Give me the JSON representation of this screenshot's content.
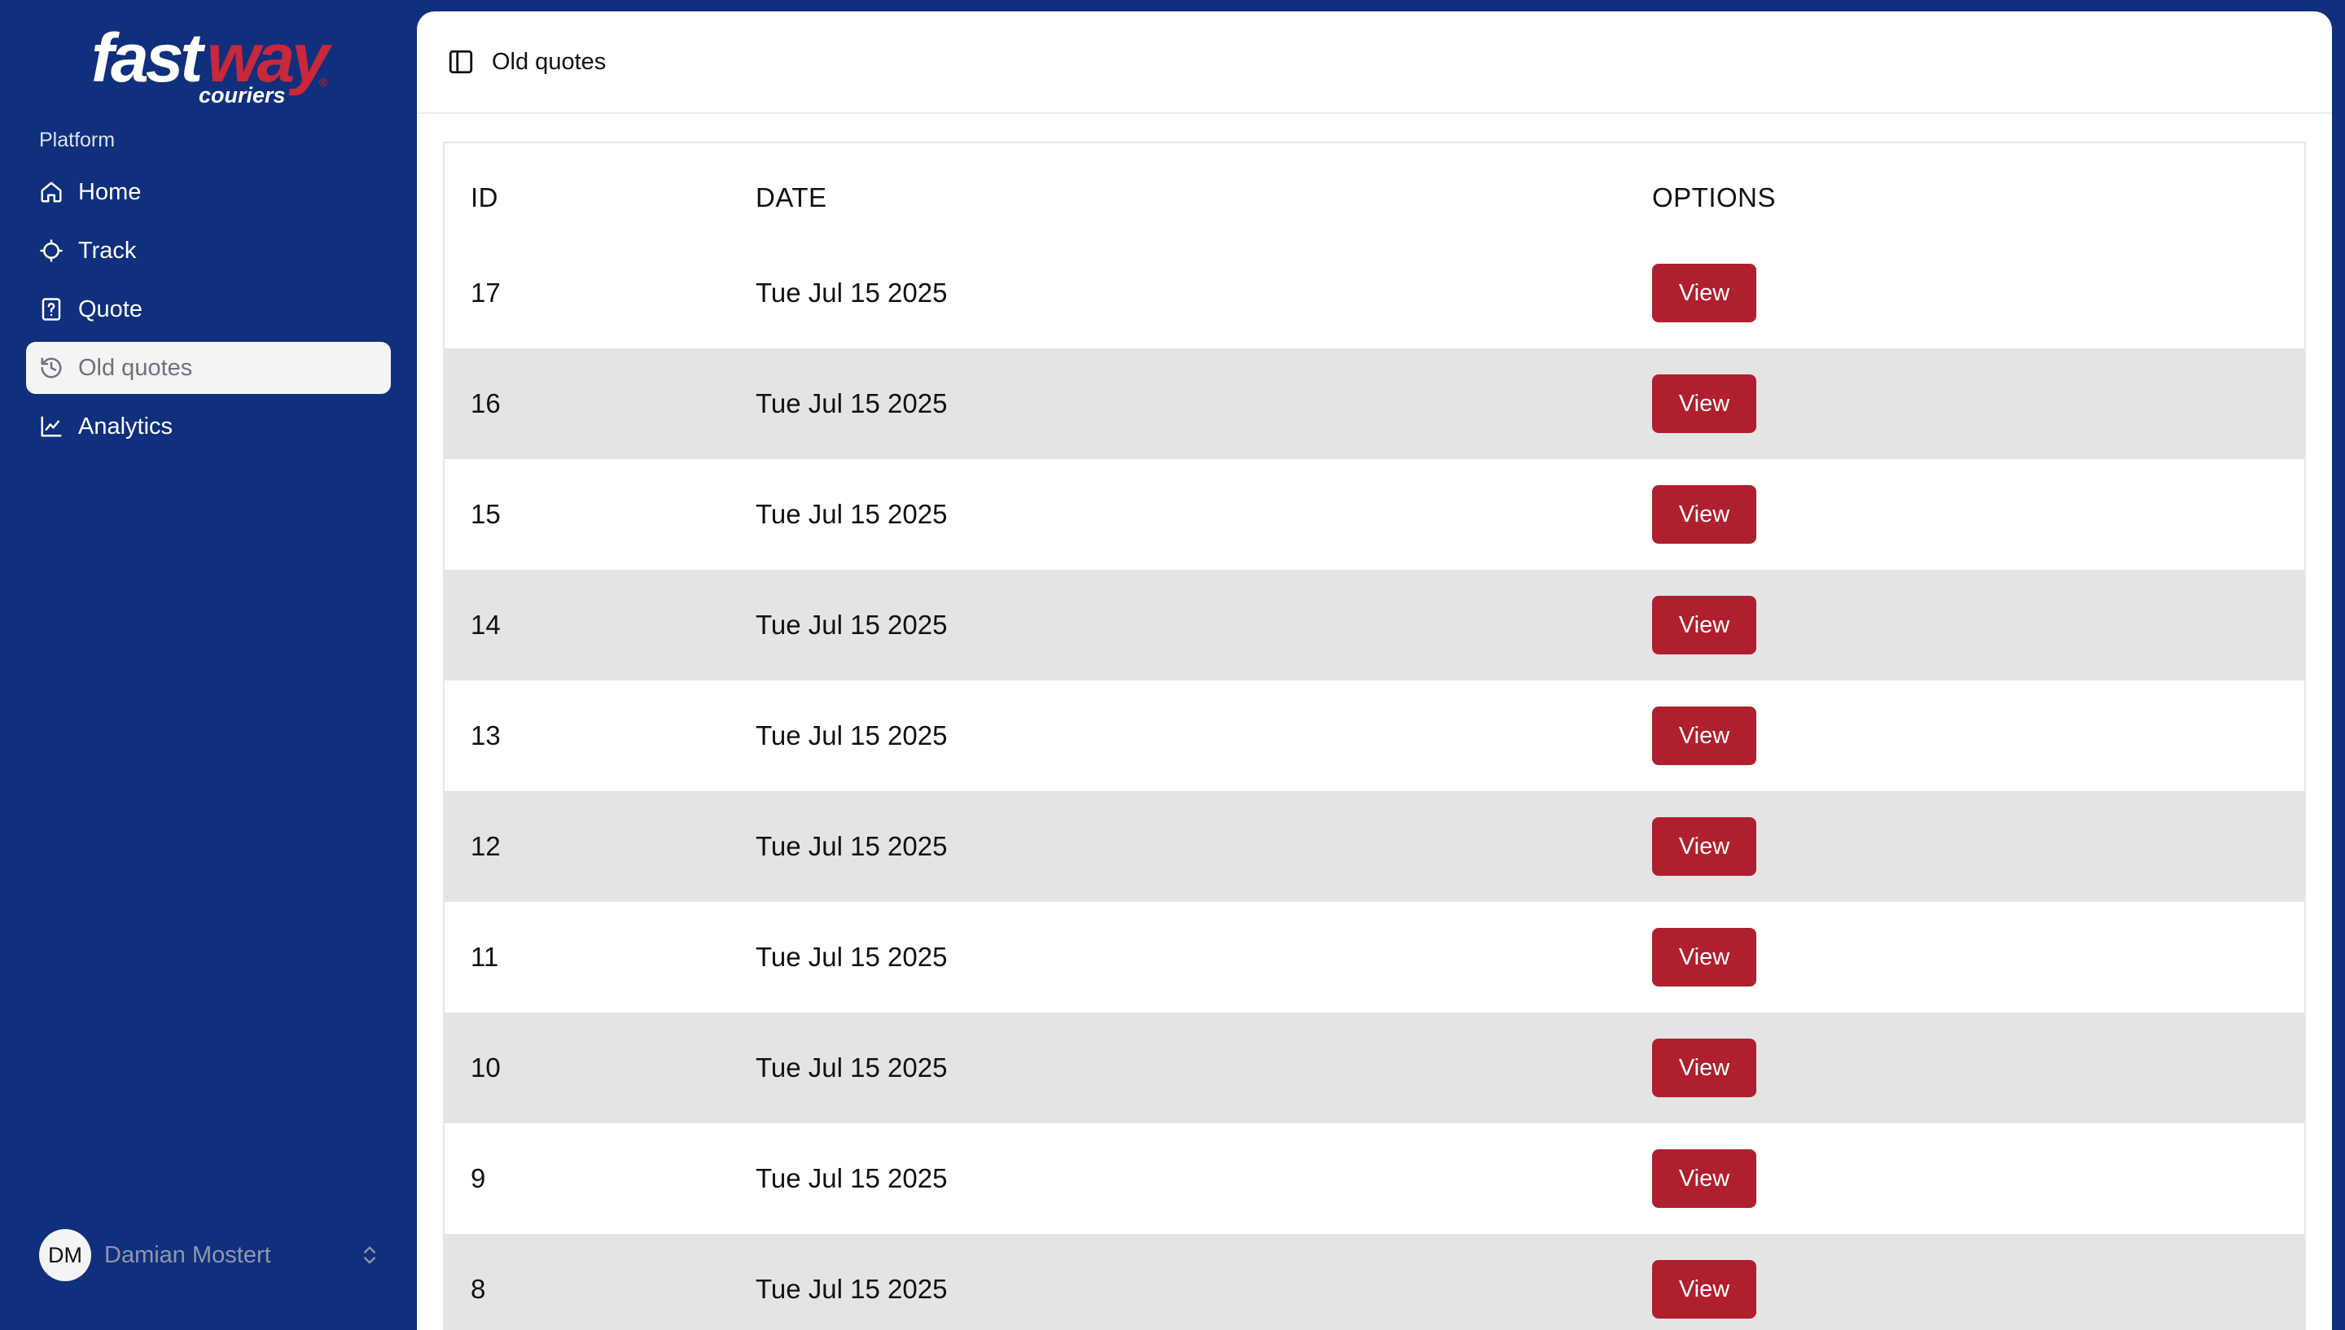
{
  "sidebar": {
    "logo": {
      "primary": "fast",
      "secondary": "way",
      "sub": "couriers",
      "mark": "®"
    },
    "section_label": "Platform",
    "items": [
      {
        "label": "Home",
        "icon": "home-icon",
        "active": false
      },
      {
        "label": "Track",
        "icon": "crosshair-icon",
        "active": false
      },
      {
        "label": "Quote",
        "icon": "file-question-icon",
        "active": false
      },
      {
        "label": "Old quotes",
        "icon": "history-icon",
        "active": true
      },
      {
        "label": "Analytics",
        "icon": "chart-line-icon",
        "active": false
      }
    ],
    "user": {
      "initials": "DM",
      "name": "Damian Mostert"
    }
  },
  "header": {
    "title": "Old quotes"
  },
  "table": {
    "columns": {
      "id": "ID",
      "date": "DATE",
      "options": "OPTIONS"
    },
    "rows": [
      {
        "id": "17",
        "date": "Tue Jul 15 2025",
        "action": "View"
      },
      {
        "id": "16",
        "date": "Tue Jul 15 2025",
        "action": "View"
      },
      {
        "id": "15",
        "date": "Tue Jul 15 2025",
        "action": "View"
      },
      {
        "id": "14",
        "date": "Tue Jul 15 2025",
        "action": "View"
      },
      {
        "id": "13",
        "date": "Tue Jul 15 2025",
        "action": "View"
      },
      {
        "id": "12",
        "date": "Tue Jul 15 2025",
        "action": "View"
      },
      {
        "id": "11",
        "date": "Tue Jul 15 2025",
        "action": "View"
      },
      {
        "id": "10",
        "date": "Tue Jul 15 2025",
        "action": "View"
      },
      {
        "id": "9",
        "date": "Tue Jul 15 2025",
        "action": "View"
      },
      {
        "id": "8",
        "date": "Tue Jul 15 2025",
        "action": "View"
      }
    ]
  },
  "colors": {
    "brand_blue": "#102f7d",
    "brand_red": "#b01f2e",
    "row_alt": "#e4e4e5"
  }
}
